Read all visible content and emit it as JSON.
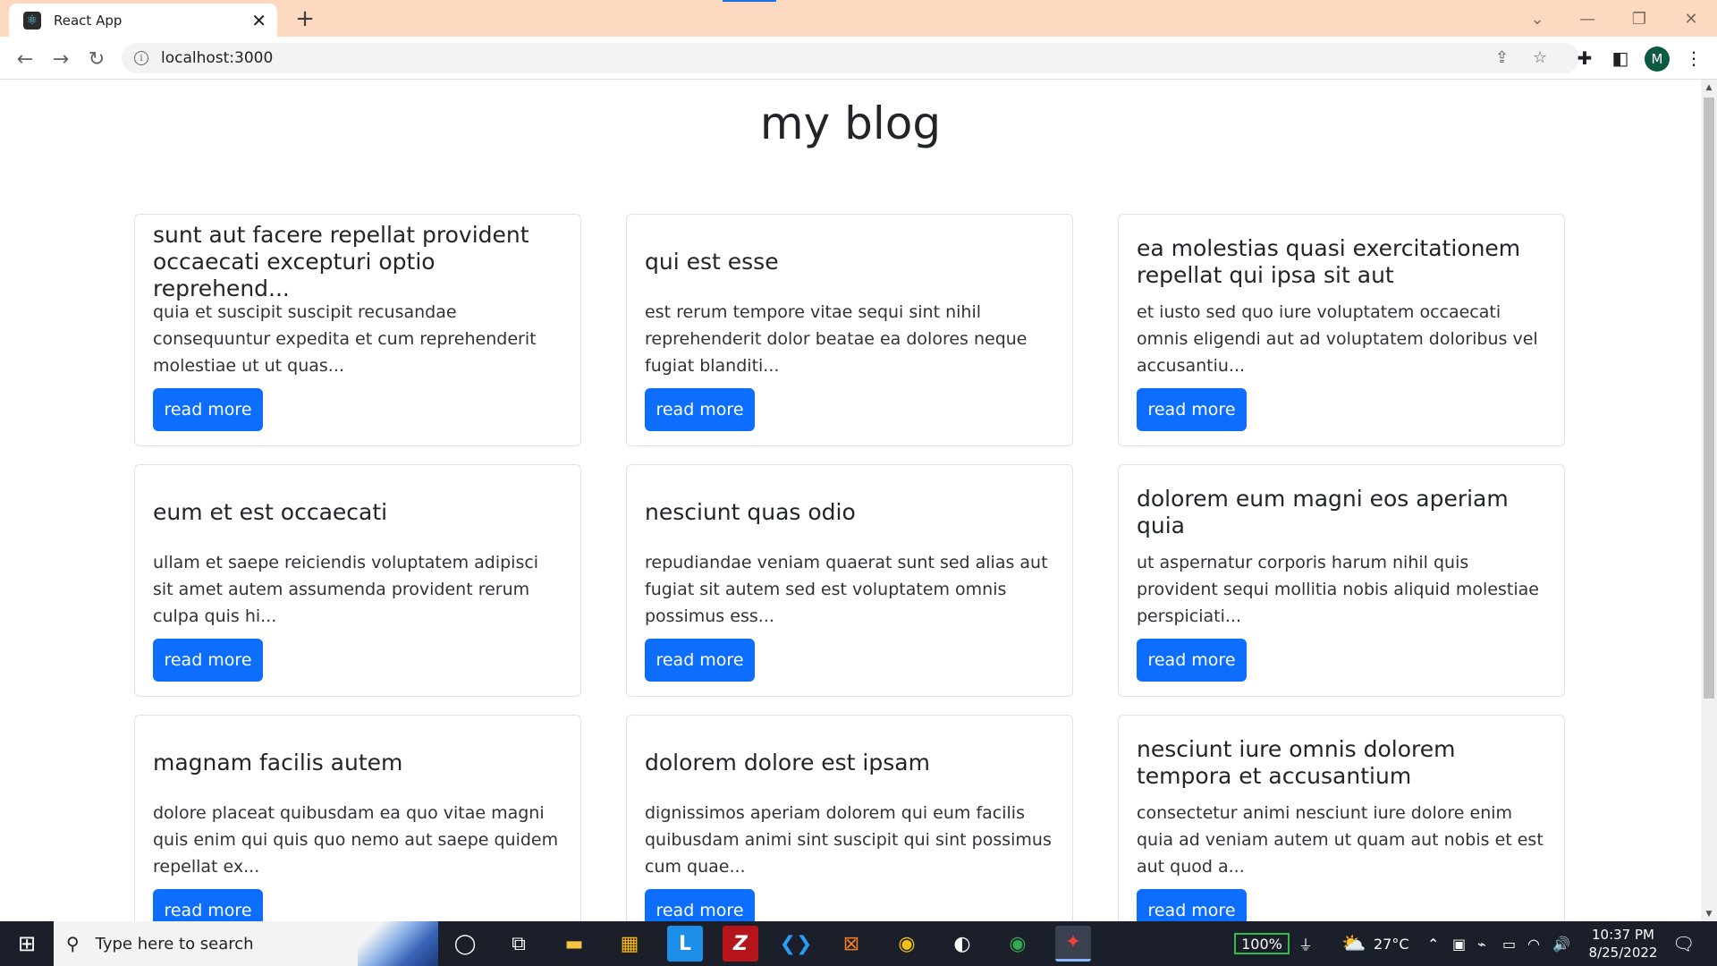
{
  "browser": {
    "tab_title": "React App",
    "tab_close": "✕",
    "new_tab": "+",
    "url": "localhost:3000",
    "profile_initial": "M",
    "window_controls": {
      "tab_search": "⌄",
      "minimize": "—",
      "restore": "❐",
      "close": "✕"
    }
  },
  "page": {
    "title": "my blog"
  },
  "posts": [
    {
      "title": "sunt aut facere repellat provident occaecati excepturi optio reprehend...",
      "body": "quia et suscipit suscipit recusandae consequuntur expedita et cum reprehenderit molestiae ut ut quas...",
      "button": "read more"
    },
    {
      "title": "qui est esse",
      "body": "est rerum tempore vitae sequi sint nihil reprehenderit dolor beatae ea dolores neque fugiat blanditi...",
      "button": "read more"
    },
    {
      "title": "ea molestias quasi exercitationem repellat qui ipsa sit aut",
      "body": "et iusto sed quo iure voluptatem occaecati omnis eligendi aut ad voluptatem doloribus vel accusantiu...",
      "button": "read more"
    },
    {
      "title": "eum et est occaecati",
      "body": "ullam et saepe reiciendis voluptatem adipisci sit amet autem assumenda provident rerum culpa quis hi...",
      "button": "read more"
    },
    {
      "title": "nesciunt quas odio",
      "body": "repudiandae veniam quaerat sunt sed alias aut fugiat sit autem sed est voluptatem omnis possimus ess...",
      "button": "read more"
    },
    {
      "title": "dolorem eum magni eos aperiam quia",
      "body": "ut aspernatur corporis harum nihil quis provident sequi mollitia nobis aliquid molestiae perspiciati...",
      "button": "read more"
    },
    {
      "title": "magnam facilis autem",
      "body": "dolore placeat quibusdam ea quo vitae magni quis enim qui quis quo nemo aut saepe quidem repellat ex...",
      "button": "read more"
    },
    {
      "title": "dolorem dolore est ipsam",
      "body": "dignissimos aperiam dolorem qui eum facilis quibusdam animi sint suscipit qui sint possimus cum quae...",
      "button": "read more"
    },
    {
      "title": "nesciunt iure omnis dolorem tempora et accusantium",
      "body": "consectetur animi nesciunt iure dolore enim quia ad veniam autem ut quam aut nobis et est aut quod a...",
      "button": "read more"
    }
  ],
  "taskbar": {
    "search_placeholder": "Type here to search",
    "battery": "100%",
    "temperature": "27°C",
    "time": "10:37 PM",
    "date": "8/25/2022"
  },
  "colors": {
    "tabbar": "#fcd9c0",
    "primary_button": "#0d6efd",
    "taskbar": "#1b1f2a"
  }
}
